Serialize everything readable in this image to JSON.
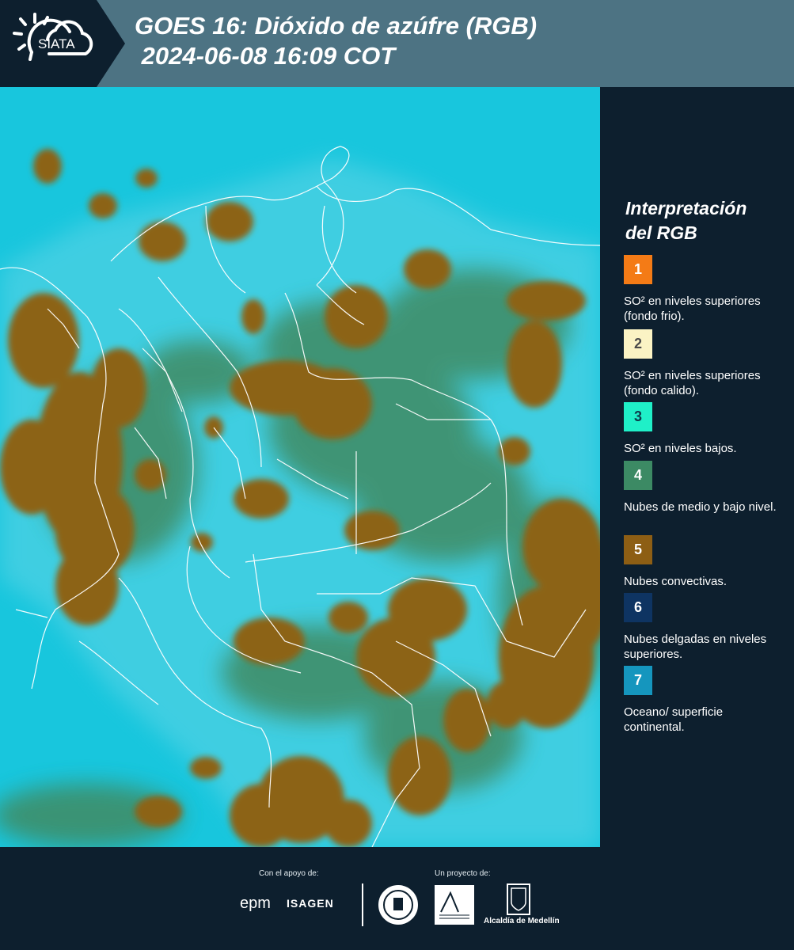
{
  "header": {
    "logo_text": "SIATA",
    "title_line1": "GOES 16: Dióxido de azúfre (RGB)",
    "title_line2": " 2024-06-08 16:09 COT"
  },
  "map": {
    "ocean_color": "#18c6dd",
    "land_color": "#2fc9de",
    "convective_cloud_color": "#8c6418",
    "mid_low_cloud_color": "#3f8b63",
    "boundary_color": "#ffffff"
  },
  "legend": {
    "title_line1": "Interpretación",
    "title_line2": "del RGB",
    "items": [
      {
        "number": "1",
        "color": "#f47b16",
        "text_color": "#ffffff",
        "text": "SO² en niveles superiores (fondo frio)."
      },
      {
        "number": "2",
        "color": "#fbf3c4",
        "text_color": "#4a4a4a",
        "text": "SO² en niveles superiores (fondo calido)."
      },
      {
        "number": "3",
        "color": "#1ff0c8",
        "text_color": "#0d3a4a",
        "text": "SO² en niveles bajos."
      },
      {
        "number": "4",
        "color": "#3c8a64",
        "text_color": "#ffffff",
        "text": "Nubes de medio y bajo nivel."
      },
      {
        "number": "5",
        "color": "#8d5e14",
        "text_color": "#ffffff",
        "text": "Nubes convectivas."
      },
      {
        "number": "6",
        "color": "#0e3462",
        "text_color": "#ffffff",
        "text": "Nubes delgadas en niveles superiores."
      },
      {
        "number": "7",
        "color": "#1596be",
        "text_color": "#ffffff",
        "text": "Oceano/ superficie continental."
      }
    ]
  },
  "footer": {
    "support_label": "Con el apoyo de:",
    "project_label": "Un proyecto de:",
    "sponsors": [
      "epm",
      "ISAGEN"
    ],
    "partners": [
      "Área Metropolitana Valle de Aburrá",
      "Alcaldía de Medellín"
    ],
    "alcaldia_label": "Alcaldía de Medellín"
  }
}
